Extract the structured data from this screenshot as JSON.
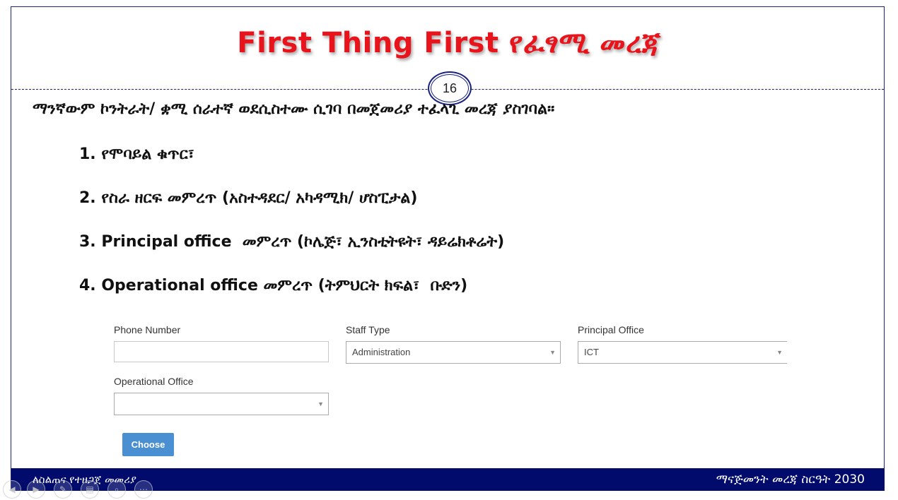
{
  "slide": {
    "title": "First Thing First የፈፃሚ መረጃ",
    "page_number": "16",
    "intro": "ማንኛውም ኮንትራት/ ቋሚ ሰራተኛ ወደሲስተሙ ሲገባ በመጀመሪያ ተፈላጊ መረጃ ያስገባል።",
    "steps": [
      "1. የሞባይል ቁጥር፣",
      "2. የስራ ዘርፍ መምረጥ (አስተዳደር/ አካዳሚክ/ ሆስፒታል)",
      "3. Principal office  መምረጥ (ኮሌጅ፣ ኢንስቲትዩት፣ ዳይሬክቶሬት)",
      "4. Operational office መምረጥ (ትምህርት ክፍል፣  ቡድን)"
    ]
  },
  "form": {
    "phone_label": "Phone Number",
    "phone_value": "",
    "staff_type_label": "Staff Type",
    "staff_type_value": "Administration",
    "principal_office_label": "Principal Office",
    "principal_office_value": "ICT",
    "operational_office_label": "Operational Office",
    "operational_office_value": "",
    "choose_label": "Choose"
  },
  "footer": {
    "left": "ለስልጠና የተዘጋጀ መመሪያ",
    "right": "ማናጅመንት መረጃ ስርዓት 2030"
  },
  "colors": {
    "title": "#e8131b",
    "footer_bg": "#000b6b",
    "button": "#4a8fd1",
    "frame": "#1a237e"
  },
  "icons": {
    "caret": "caret-down-icon",
    "controls": [
      "previous-icon",
      "play-icon",
      "pen-icon",
      "slides-icon",
      "zoom-icon",
      "more-icon"
    ]
  }
}
